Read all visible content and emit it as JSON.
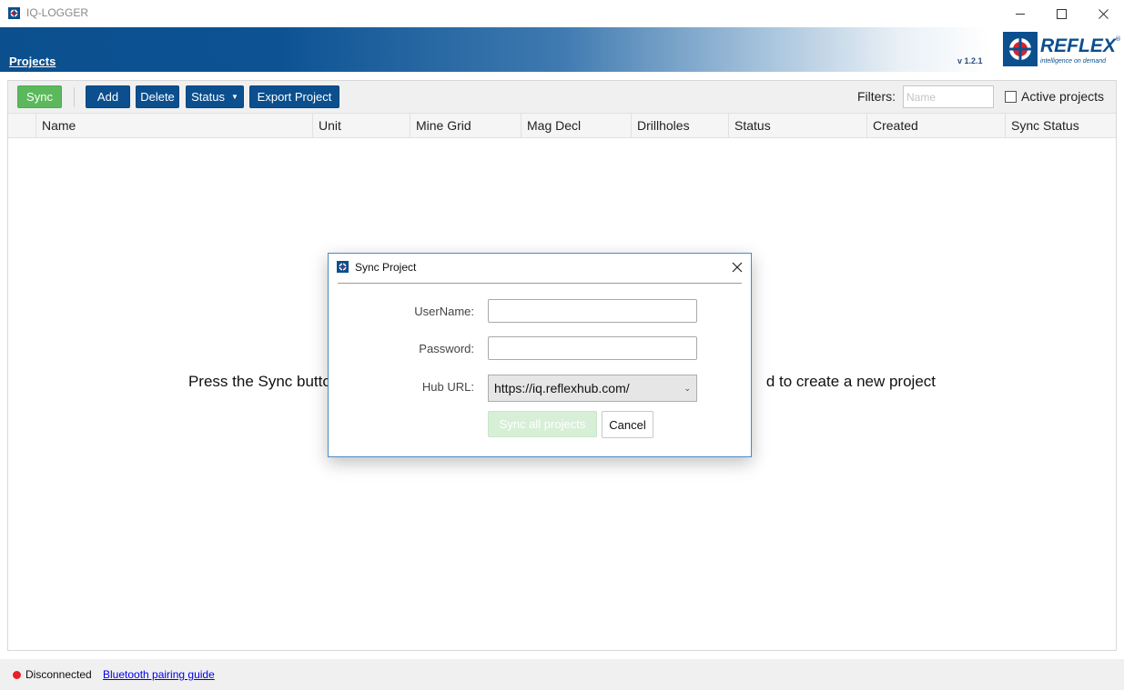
{
  "window": {
    "title": "IQ-LOGGER",
    "minimize_icon": "minimize-icon",
    "maximize_icon": "maximize-icon",
    "close_icon": "close-icon"
  },
  "header": {
    "nav_link": "Projects",
    "version": "v 1.2.1",
    "logo": {
      "word": "REFLEX",
      "registered": "®",
      "tagline": "intelligence on demand"
    }
  },
  "toolbar": {
    "sync_label": "Sync",
    "add_label": "Add",
    "delete_label": "Delete",
    "status_label": "Status",
    "export_label": "Export Project",
    "filters_label": "Filters:",
    "filter_placeholder": "Name",
    "filter_value": "",
    "active_projects_label": "Active projects",
    "active_projects_checked": false
  },
  "table": {
    "columns": [
      "Name",
      "Unit",
      "Mine Grid",
      "Mag Decl",
      "Drillholes",
      "Status",
      "Created",
      "Sync Status"
    ],
    "rows": [],
    "empty_message": "Press the Sync button to download your projects from the hub or press Add to create a new project",
    "visible_fragments": [
      "Press the Sync butto",
      "d to create a new project"
    ]
  },
  "statusbar": {
    "connection_status": "Disconnected",
    "bluetooth_link": "Bluetooth pairing guide"
  },
  "dialog": {
    "title": "Sync Project",
    "username_label": "UserName:",
    "username_value": "",
    "password_label": "Password:",
    "password_value": "",
    "hub_url_label": "Hub URL:",
    "hub_url_value": "https://iq.reflexhub.com/",
    "sync_all_label": "Sync all projects",
    "cancel_label": "Cancel"
  },
  "colors": {
    "brand_blue": "#0b4f8e",
    "sync_green": "#5cb85c",
    "disconnected_red": "#e8202a",
    "link_blue": "#0000ee"
  }
}
